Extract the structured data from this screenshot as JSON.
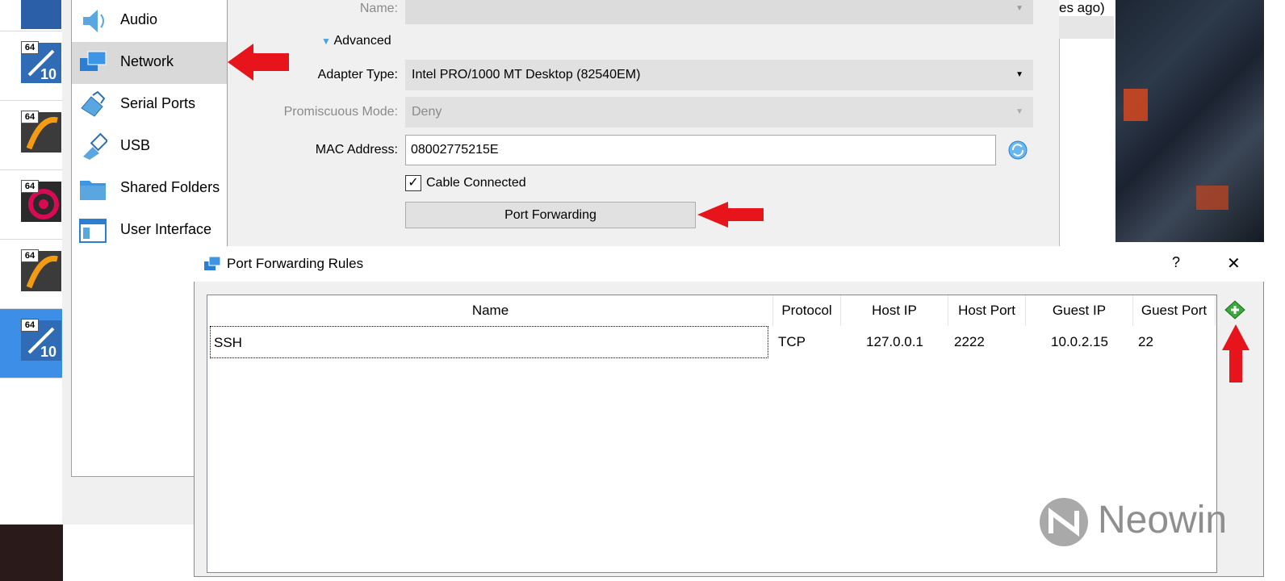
{
  "settings": {
    "sidebar": {
      "items": [
        {
          "label": "Audio",
          "icon": "audio-icon"
        },
        {
          "label": "Network",
          "icon": "network-icon"
        },
        {
          "label": "Serial Ports",
          "icon": "serial-port-icon"
        },
        {
          "label": "USB",
          "icon": "usb-icon"
        },
        {
          "label": "Shared Folders",
          "icon": "folder-icon"
        },
        {
          "label": "User Interface",
          "icon": "user-interface-icon"
        }
      ],
      "selected": "Network"
    },
    "network": {
      "name_label": "Name:",
      "advanced_label": "Advanced",
      "adapter_type_label": "Adapter Type:",
      "adapter_type_value": "Intel PRO/1000 MT Desktop (82540EM)",
      "promiscuous_label": "Promiscuous Mode:",
      "promiscuous_value": "Deny",
      "mac_label": "MAC Address:",
      "mac_value": "08002775215E",
      "cable_label": "Cable Connected",
      "cable_checked": true,
      "port_forwarding_button": "Port Forwarding"
    }
  },
  "background": {
    "partial_text": "es ago)",
    "vm_badge": "64",
    "vm_version": "10"
  },
  "port_forwarding": {
    "title": "Port Forwarding Rules",
    "help_label": "?",
    "close_label": "✕",
    "columns": [
      "Name",
      "Protocol",
      "Host IP",
      "Host Port",
      "Guest IP",
      "Guest Port"
    ],
    "rows": [
      {
        "name": "SSH",
        "protocol": "TCP",
        "host_ip": "127.0.0.1",
        "host_port": "2222",
        "guest_ip": "10.0.2.15",
        "guest_port": "22"
      }
    ],
    "add_icon": "add-rule-icon"
  },
  "watermark": "Neowin",
  "colors": {
    "accent_blue": "#3d8ee6",
    "arrow_red": "#e8141c",
    "add_green": "#3aa83a"
  }
}
